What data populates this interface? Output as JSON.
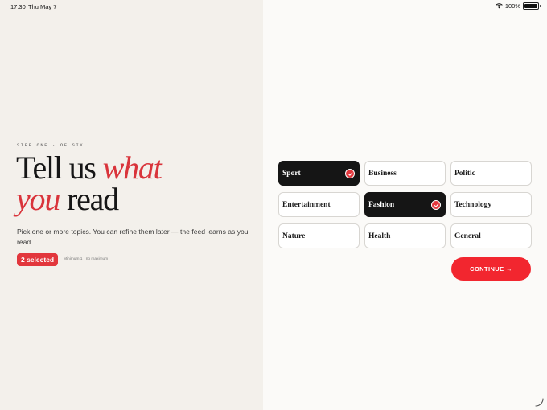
{
  "status_bar": {
    "time": "17:30",
    "date": "Thu May 7",
    "battery": "100%",
    "battery_level": 1.0
  },
  "onboarding": {
    "step_label": "STEP ONE · OF SIX",
    "headline_part1": "Tell us ",
    "headline_accent1": "what",
    "headline_accent2": "you",
    "headline_part2": " read",
    "description": "Pick one or more topics. You can refine them later — the feed learns as you read.",
    "selected_badge": "2 selected",
    "minimum_note": "Minimum 1 · no maximum"
  },
  "topics": [
    {
      "label": "Sport",
      "selected": true
    },
    {
      "label": "Business",
      "selected": false
    },
    {
      "label": "Politic",
      "selected": false
    },
    {
      "label": "Entertainment",
      "selected": false
    },
    {
      "label": "Fashion",
      "selected": true
    },
    {
      "label": "Technology",
      "selected": false
    },
    {
      "label": "Nature",
      "selected": false
    },
    {
      "label": "Health",
      "selected": false
    },
    {
      "label": "General",
      "selected": false
    }
  ],
  "continue_button": {
    "label": "CONTINUE →"
  },
  "colors": {
    "accent": "#e2373d",
    "selected_tile": "#151515",
    "left_panel": "#f3f0eb",
    "right_panel": "#fbfaf8"
  }
}
